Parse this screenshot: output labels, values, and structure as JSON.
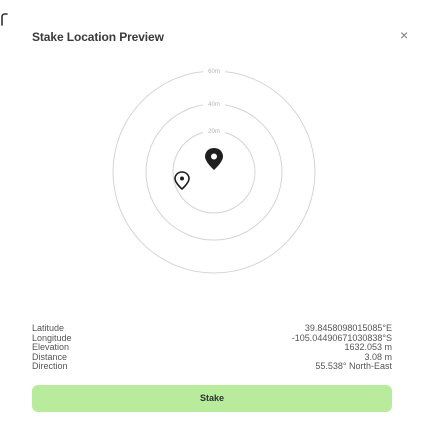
{
  "dialog": {
    "title": "Stake Location Preview",
    "close_glyph": "×"
  },
  "radar": {
    "ring_labels": [
      "60m",
      "40m",
      "20m"
    ],
    "target_marker": "map-pin",
    "user_marker": "location-pin"
  },
  "info": {
    "rows": [
      {
        "label": "Latitude",
        "value": "39.8458098015085°E"
      },
      {
        "label": "Longitude",
        "value": "-105.04490671030838°S"
      },
      {
        "label": "Elevation",
        "value": "1632.053 m"
      },
      {
        "label": "Distance",
        "value": "3.08 m"
      },
      {
        "label": "Direction",
        "value": "55.538° North-East"
      }
    ]
  },
  "actions": {
    "stake_label": "Stake"
  },
  "colors": {
    "accent_button": "#b8ec9c",
    "ring_stroke": "#d4d4d4"
  }
}
